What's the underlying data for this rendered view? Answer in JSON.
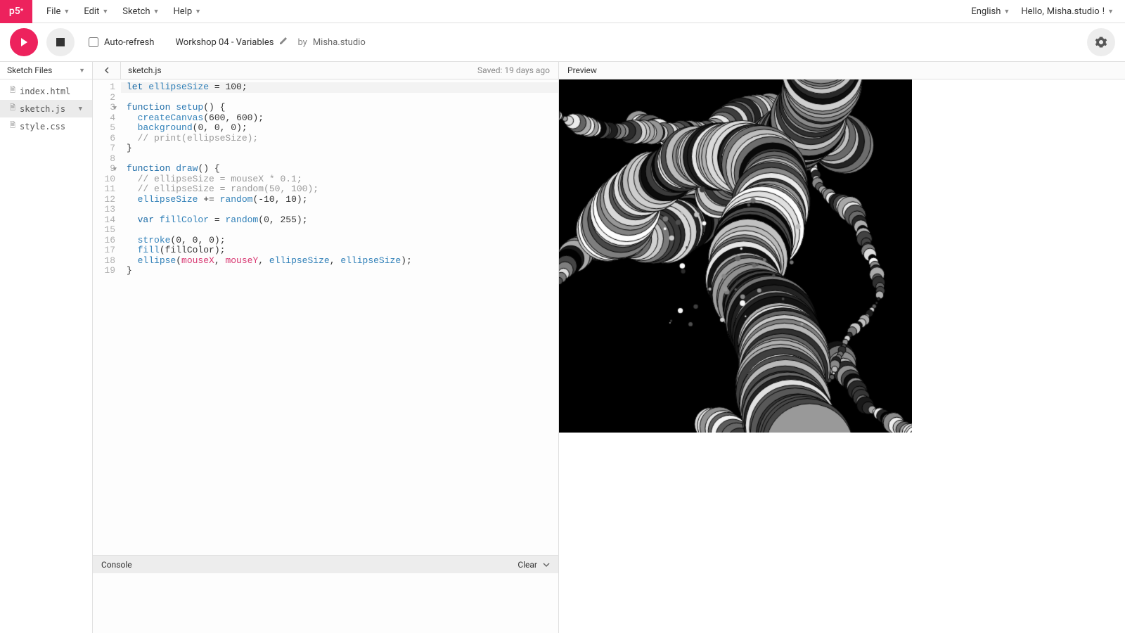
{
  "logo": "p5",
  "menu": [
    "File",
    "Edit",
    "Sketch",
    "Help"
  ],
  "language": "English",
  "greeting_prefix": "Hello, ",
  "username": "Misha.studio",
  "greeting_suffix": "!",
  "autorefresh_label": "Auto-refresh",
  "sketch_title": "Workshop 04 - Variables",
  "by_label": "by",
  "author": "Misha.studio",
  "sidebar_title": "Sketch Files",
  "files": [
    {
      "name": "index.html",
      "active": false
    },
    {
      "name": "sketch.js",
      "active": true
    },
    {
      "name": "style.css",
      "active": false
    }
  ],
  "open_file": "sketch.js",
  "saved_text": "Saved: 19 days ago",
  "preview_label": "Preview",
  "console_label": "Console",
  "clear_label": "Clear",
  "code": [
    [
      [
        "k",
        "let "
      ],
      [
        "builtin",
        "ellipseSize"
      ],
      [
        "",
        " = "
      ],
      [
        "num",
        "100"
      ],
      [
        "",
        ";"
      ]
    ],
    [],
    [
      [
        "k",
        "function "
      ],
      [
        "fnname",
        "setup"
      ],
      [
        "",
        "() {"
      ]
    ],
    [
      [
        "",
        "  "
      ],
      [
        "builtin",
        "createCanvas"
      ],
      [
        "",
        "("
      ],
      [
        "num",
        "600"
      ],
      [
        "",
        ", "
      ],
      [
        "num",
        "600"
      ],
      [
        "",
        ");"
      ]
    ],
    [
      [
        "",
        "  "
      ],
      [
        "builtin",
        "background"
      ],
      [
        "",
        "("
      ],
      [
        "num",
        "0"
      ],
      [
        "",
        ", "
      ],
      [
        "num",
        "0"
      ],
      [
        "",
        ", "
      ],
      [
        "num",
        "0"
      ],
      [
        "",
        ");"
      ]
    ],
    [
      [
        "",
        "  "
      ],
      [
        "cm",
        "// print(ellipseSize);"
      ]
    ],
    [
      [
        "",
        "}"
      ]
    ],
    [],
    [
      [
        "k",
        "function "
      ],
      [
        "fnname",
        "draw"
      ],
      [
        "",
        "() {"
      ]
    ],
    [
      [
        "",
        "  "
      ],
      [
        "cm",
        "// ellipseSize = mouseX * 0.1;"
      ]
    ],
    [
      [
        "",
        "  "
      ],
      [
        "cm",
        "// ellipseSize = random(50, 100);"
      ]
    ],
    [
      [
        "",
        "  "
      ],
      [
        "builtin",
        "ellipseSize"
      ],
      [
        "",
        " += "
      ],
      [
        "builtin",
        "random"
      ],
      [
        "",
        "(-"
      ],
      [
        "num",
        "10"
      ],
      [
        "",
        ", "
      ],
      [
        "num",
        "10"
      ],
      [
        "",
        ");"
      ]
    ],
    [],
    [
      [
        "",
        "  "
      ],
      [
        "k",
        "var "
      ],
      [
        "builtin",
        "fillColor"
      ],
      [
        "",
        " = "
      ],
      [
        "builtin",
        "random"
      ],
      [
        "",
        "("
      ],
      [
        "num",
        "0"
      ],
      [
        "",
        ", "
      ],
      [
        "num",
        "255"
      ],
      [
        "",
        ");"
      ]
    ],
    [],
    [
      [
        "",
        "  "
      ],
      [
        "builtin",
        "stroke"
      ],
      [
        "",
        "("
      ],
      [
        "num",
        "0"
      ],
      [
        "",
        ", "
      ],
      [
        "num",
        "0"
      ],
      [
        "",
        ", "
      ],
      [
        "num",
        "0"
      ],
      [
        "",
        ");"
      ]
    ],
    [
      [
        "",
        "  "
      ],
      [
        "builtin",
        "fill"
      ],
      [
        "",
        "(fillColor);"
      ]
    ],
    [
      [
        "",
        "  "
      ],
      [
        "builtin",
        "ellipse"
      ],
      [
        "",
        "("
      ],
      [
        "special",
        "mouseX"
      ],
      [
        "",
        ", "
      ],
      [
        "special",
        "mouseY"
      ],
      [
        "",
        ", "
      ],
      [
        "builtin",
        "ellipseSize"
      ],
      [
        "",
        ", "
      ],
      [
        "builtin",
        "ellipseSize"
      ],
      [
        "",
        ");"
      ]
    ],
    [
      [
        "",
        "}"
      ]
    ]
  ],
  "fold_lines": [
    3,
    9
  ],
  "highlighted_line": 1
}
